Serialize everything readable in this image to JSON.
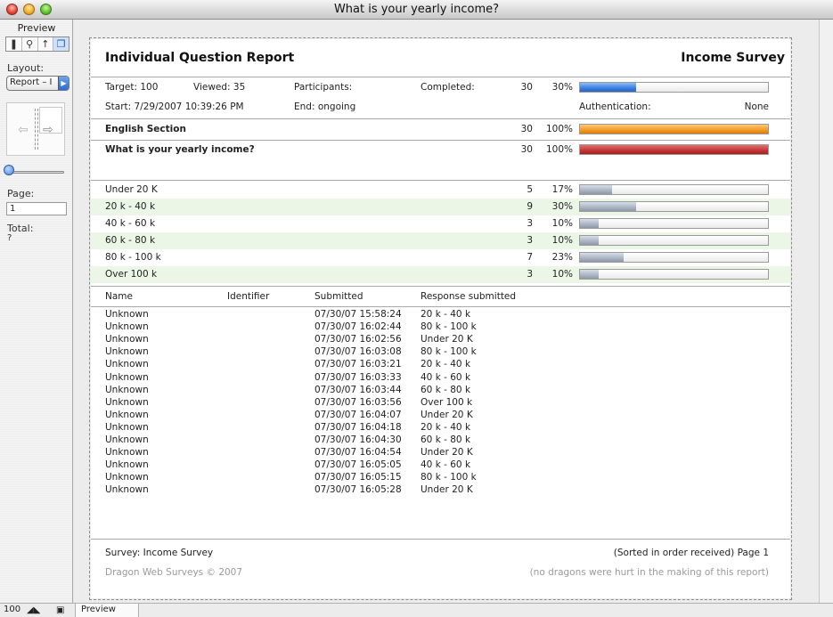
{
  "window": {
    "title": "What is your yearly income?"
  },
  "sidebar": {
    "title": "Preview",
    "tools": [
      "❚",
      "⚲",
      "↑",
      "❐"
    ],
    "layout_label": "Layout:",
    "layout_value": "Report – I",
    "page_label": "Page:",
    "page_value": "1",
    "total_label": "Total:",
    "total_value": "?"
  },
  "statusbar": {
    "zoom": "100",
    "mode": "Preview"
  },
  "report": {
    "title": "Individual Question Report",
    "survey_name": "Income  Survey",
    "stats": {
      "target": "Target: 100",
      "viewed": "Viewed: 35",
      "participants": "Participants:",
      "completed_label": "Completed:",
      "completed_count": "30",
      "completed_pct": "30%",
      "completed_fraction": 0.3,
      "start": "Start:  7/29/2007 10:39:26 PM",
      "end": "End:  ongoing",
      "auth_label": "Authentication:",
      "auth_value": "None"
    },
    "section": {
      "name": "English Section",
      "count": "30",
      "pct": "100%",
      "fraction": 1.0
    },
    "question": {
      "text": "What is your yearly income?",
      "count": "30",
      "pct": "100%",
      "fraction": 1.0
    },
    "answers": [
      {
        "label": "Under 20 K",
        "count": "5",
        "pct": "17%",
        "fraction": 0.17
      },
      {
        "label": "20 k - 40 k",
        "count": "9",
        "pct": "30%",
        "fraction": 0.3
      },
      {
        "label": "40 k - 60 k",
        "count": "3",
        "pct": "10%",
        "fraction": 0.1
      },
      {
        "label": "60 k - 80 k",
        "count": "3",
        "pct": "10%",
        "fraction": 0.1
      },
      {
        "label": "80 k - 100 k",
        "count": "7",
        "pct": "23%",
        "fraction": 0.23
      },
      {
        "label": "Over 100 k",
        "count": "3",
        "pct": "10%",
        "fraction": 0.1
      }
    ],
    "columns": [
      "Name",
      "Identifier",
      "Submitted",
      "Response submitted"
    ],
    "responses": [
      [
        "Unknown",
        "07/30/07 15:58:24",
        "20 k - 40 k"
      ],
      [
        "Unknown",
        "07/30/07 16:02:44",
        "80 k - 100 k"
      ],
      [
        "Unknown",
        "07/30/07 16:02:56",
        "Under 20 K"
      ],
      [
        "Unknown",
        "07/30/07 16:03:08",
        "80 k - 100 k"
      ],
      [
        "Unknown",
        "07/30/07 16:03:21",
        "20 k - 40 k"
      ],
      [
        "Unknown",
        "07/30/07 16:03:33",
        "40 k - 60 k"
      ],
      [
        "Unknown",
        "07/30/07 16:03:44",
        "60 k - 80 k"
      ],
      [
        "Unknown",
        "07/30/07 16:03:56",
        "Over 100 k"
      ],
      [
        "Unknown",
        "07/30/07 16:04:07",
        "Under 20 K"
      ],
      [
        "Unknown",
        "07/30/07 16:04:18",
        "20 k - 40 k"
      ],
      [
        "Unknown",
        "07/30/07 16:04:30",
        "60 k - 80 k"
      ],
      [
        "Unknown",
        "07/30/07 16:04:54",
        "Under 20 K"
      ],
      [
        "Unknown",
        "07/30/07 16:05:05",
        "40 k - 60 k"
      ],
      [
        "Unknown",
        "07/30/07 16:05:15",
        "80 k - 100 k"
      ],
      [
        "Unknown",
        "07/30/07 16:05:28",
        "Under 20 K"
      ]
    ],
    "footer": {
      "survey": "Survey: Income  Survey",
      "sorted": "(Sorted in order received) Page 1",
      "copyright": "Dragon Web Surveys © 2007",
      "note": "(no dragons were hurt in the making of this report)"
    }
  },
  "colors": {
    "blue_bar": "#3a7fe0",
    "orange_bar": "#f39a24",
    "red_bar": "#c43535",
    "gray_bar": "#a9b3c2",
    "alt_row": "#ecf6e6"
  }
}
